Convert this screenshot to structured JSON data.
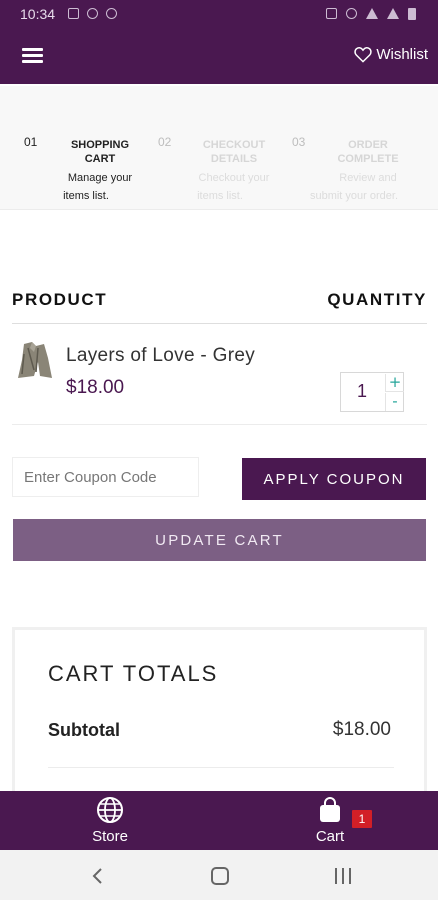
{
  "status_bar": {
    "time": "10:34",
    "left_icons": [
      "gallery-icon",
      "location-icon",
      "nfc-icon"
    ],
    "right_icons": [
      "mute-icon",
      "alarm-icon",
      "wifi-icon",
      "signal-icon",
      "battery-icon"
    ]
  },
  "header": {
    "menu_icon": "hamburger-menu-icon",
    "wishlist_label": "Wishlist",
    "wishlist_icon": "heart-icon",
    "background": "#4a1850"
  },
  "steps": [
    {
      "number": "01",
      "title_line1": "SHOPPING",
      "title_line2": "CART",
      "desc_line1": "Manage your",
      "desc_line2": "items list.",
      "active": true
    },
    {
      "number": "02",
      "title_line1": "CHECKOUT",
      "title_line2": "DETAILS",
      "desc_line1": "Checkout your",
      "desc_line2": "items list.",
      "active": false
    },
    {
      "number": "03",
      "title_line1": "ORDER",
      "title_line2": "COMPLETE",
      "desc_line1": "Review and",
      "desc_line2": "submit your order.",
      "active": false
    }
  ],
  "cart_table": {
    "col_product": "PRODUCT",
    "col_quantity": "QUANTITY",
    "items": [
      {
        "name": "Layers of Love - Grey",
        "price": "$18.00",
        "quantity": "1",
        "plus": "+",
        "minus": "-"
      }
    ]
  },
  "coupon": {
    "placeholder": "Enter Coupon Code",
    "apply_label": "APPLY COUPON"
  },
  "update_label": "UPDATE CART",
  "totals": {
    "title": "CART TOTALS",
    "subtotal_label": "Subtotal",
    "subtotal_value": "$18.00"
  },
  "tabbar": {
    "store_label": "Store",
    "store_icon": "globe-icon",
    "cart_label": "Cart",
    "cart_icon": "shopping-bag-icon",
    "cart_badge": "1"
  },
  "colors": {
    "brand": "#4a1850",
    "update_button": "#7c5f84",
    "qty_accent": "#25a59a",
    "badge": "#d21f27"
  }
}
